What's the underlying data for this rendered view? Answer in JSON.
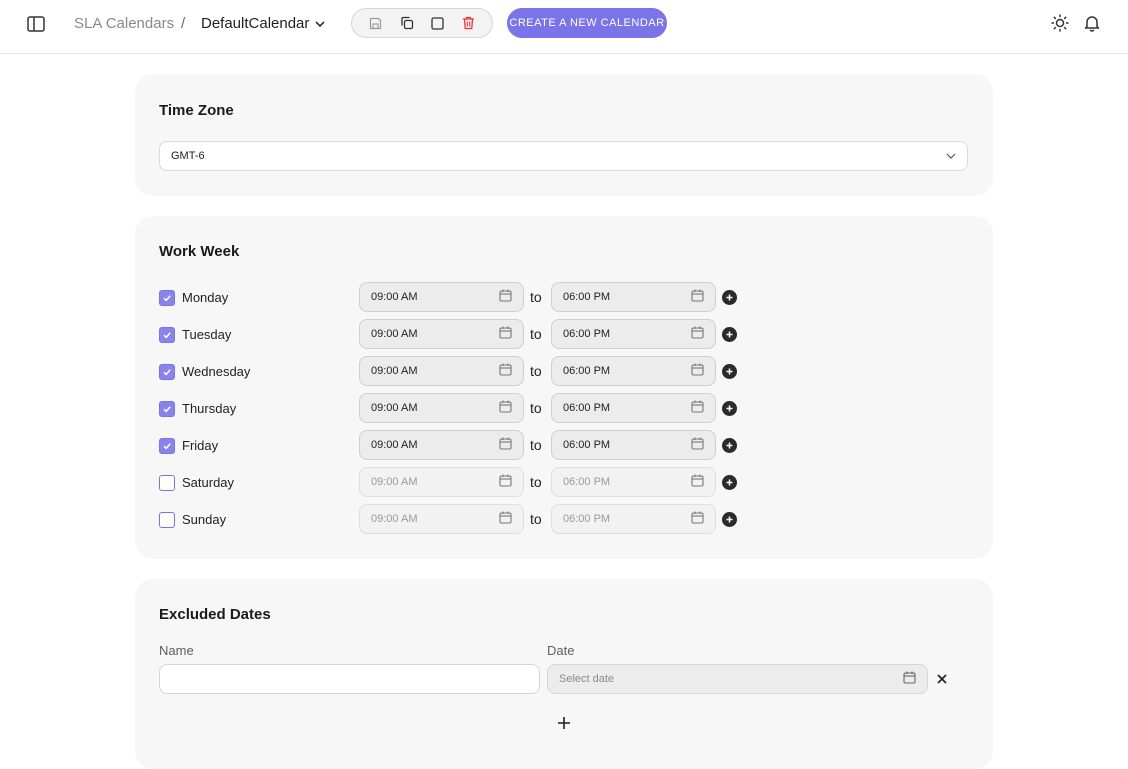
{
  "header": {
    "breadcrumb_root": "SLA Calendars",
    "breadcrumb_separator": "/",
    "current_calendar": "DefaultCalendar",
    "create_button": "CREATE A NEW CALENDAR",
    "icons": [
      "sidebar-toggle-icon",
      "save-icon",
      "copy-icon",
      "square-icon",
      "trash-icon",
      "sun-icon",
      "bell-icon"
    ]
  },
  "timezone": {
    "title": "Time Zone",
    "value": "GMT-6"
  },
  "work_week": {
    "title": "Work Week",
    "to_label": "to",
    "days": [
      {
        "label": "Monday",
        "checked": true,
        "start": "09:00 AM",
        "end": "06:00 PM"
      },
      {
        "label": "Tuesday",
        "checked": true,
        "start": "09:00 AM",
        "end": "06:00 PM"
      },
      {
        "label": "Wednesday",
        "checked": true,
        "start": "09:00 AM",
        "end": "06:00 PM"
      },
      {
        "label": "Thursday",
        "checked": true,
        "start": "09:00 AM",
        "end": "06:00 PM"
      },
      {
        "label": "Friday",
        "checked": true,
        "start": "09:00 AM",
        "end": "06:00 PM"
      },
      {
        "label": "Saturday",
        "checked": false,
        "start": "09:00 AM",
        "end": "06:00 PM"
      },
      {
        "label": "Sunday",
        "checked": false,
        "start": "09:00 AM",
        "end": "06:00 PM"
      }
    ]
  },
  "excluded_dates": {
    "title": "Excluded Dates",
    "name_label": "Name",
    "date_label": "Date",
    "name_value": "",
    "date_placeholder": "Select date"
  },
  "colors": {
    "accent": "#7b73e8",
    "danger": "#e53935"
  }
}
